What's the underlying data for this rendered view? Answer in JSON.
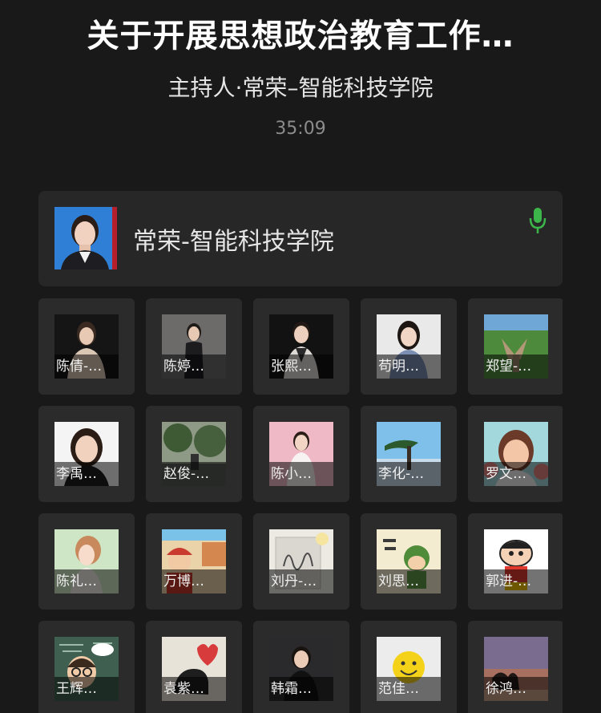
{
  "meeting": {
    "title": "关于开展思想政治教育工作…",
    "host": "主持人·常荣–智能科技学院",
    "elapsed": "35:09"
  },
  "speaker": {
    "name": "常荣-智能科技学院",
    "mic_icon": "microphone-icon",
    "mic_color": "#3cb54a"
  },
  "participants": [
    {
      "label": "陈倩-…"
    },
    {
      "label": "陈婷…"
    },
    {
      "label": "张熙…"
    },
    {
      "label": "苟明…"
    },
    {
      "label": "郑望-…"
    },
    {
      "label": "李禹…"
    },
    {
      "label": "赵俊-…"
    },
    {
      "label": "陈小…"
    },
    {
      "label": "李化-…"
    },
    {
      "label": "罗文…"
    },
    {
      "label": "陈礼…"
    },
    {
      "label": "万博…"
    },
    {
      "label": "刘丹-…"
    },
    {
      "label": "刘思…"
    },
    {
      "label": "郭进-…"
    },
    {
      "label": "王辉…"
    },
    {
      "label": "袁紫…"
    },
    {
      "label": "韩霜…"
    },
    {
      "label": "范佳…"
    },
    {
      "label": "徐鸿…"
    }
  ]
}
